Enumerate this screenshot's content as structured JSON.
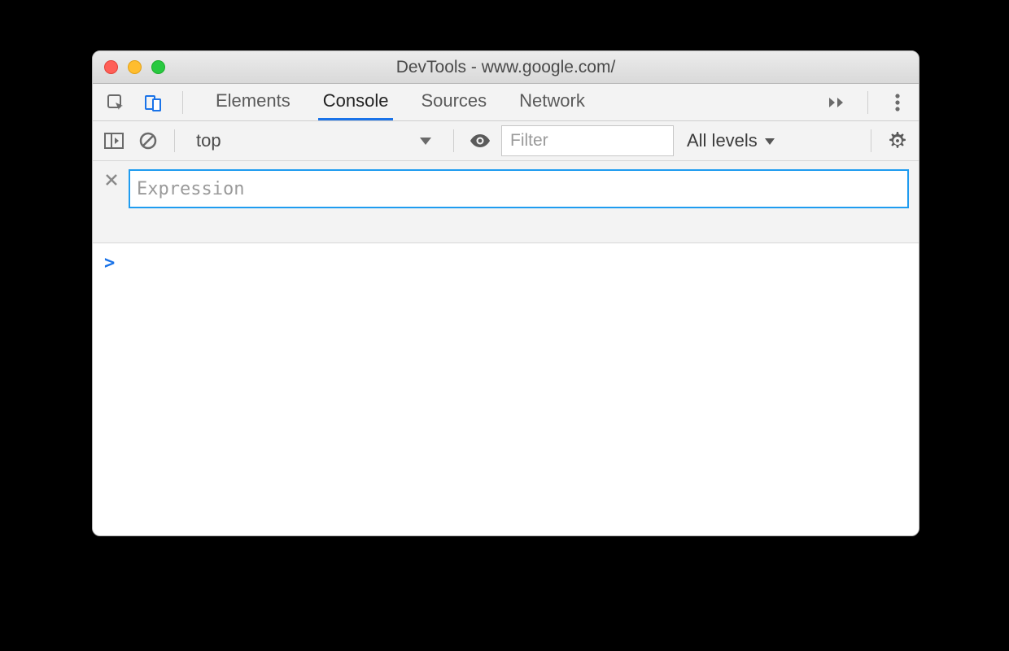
{
  "window": {
    "title": "DevTools - www.google.com/"
  },
  "tabs": {
    "items": [
      "Elements",
      "Console",
      "Sources",
      "Network"
    ],
    "active": "Console"
  },
  "console_toolbar": {
    "context": "top",
    "filter_placeholder": "Filter",
    "levels_label": "All levels"
  },
  "live_expression": {
    "placeholder": "Expression",
    "value": ""
  },
  "prompt_symbol": ">",
  "icons": {
    "inspect": "inspect-element-icon",
    "device": "device-toolbar-icon",
    "overflow": "overflow-chevrons-icon",
    "kebab": "kebab-menu-icon",
    "sidebar": "show-console-sidebar-icon",
    "clear": "clear-console-icon",
    "eye": "live-expression-eye-icon",
    "settings": "settings-gear-icon",
    "close": "close-icon"
  }
}
